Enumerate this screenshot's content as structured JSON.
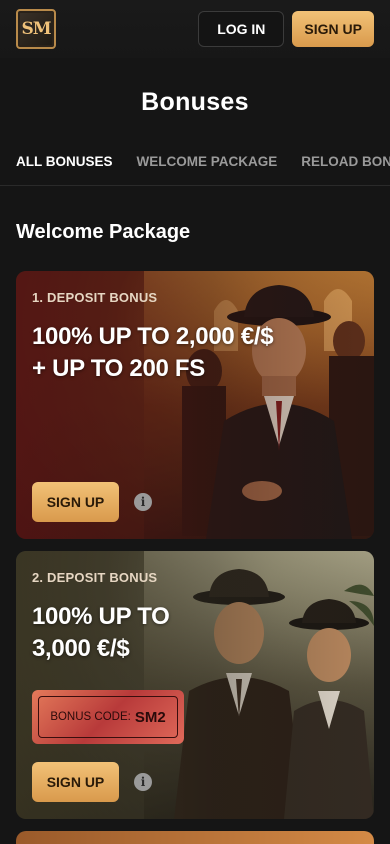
{
  "header": {
    "logo_text": "SM",
    "login_label": "LOG IN",
    "signup_label": "SIGN UP"
  },
  "page_title": "Bonuses",
  "tabs": [
    {
      "label": "ALL BONUSES",
      "active": true
    },
    {
      "label": "WELCOME PACKAGE",
      "active": false
    },
    {
      "label": "RELOAD BONUS",
      "active": false
    }
  ],
  "section_title": "Welcome Package",
  "cards": [
    {
      "label": "1. DEPOSIT BONUS",
      "headline_line1": "100% UP TO 2,000 €/$",
      "headline_line2": "+ UP TO 200 FS",
      "signup_label": "SIGN UP",
      "info_icon": "info-icon"
    },
    {
      "label": "2. DEPOSIT BONUS",
      "headline_line1": "100% UP TO",
      "headline_line2": "3,000 €/$",
      "bonus_code_label": "BONUS CODE:",
      "bonus_code_value": "SM2",
      "signup_label": "SIGN UP",
      "info_icon": "info-icon"
    }
  ],
  "colors": {
    "accent_gold": "#f0b865",
    "background": "#151515"
  }
}
